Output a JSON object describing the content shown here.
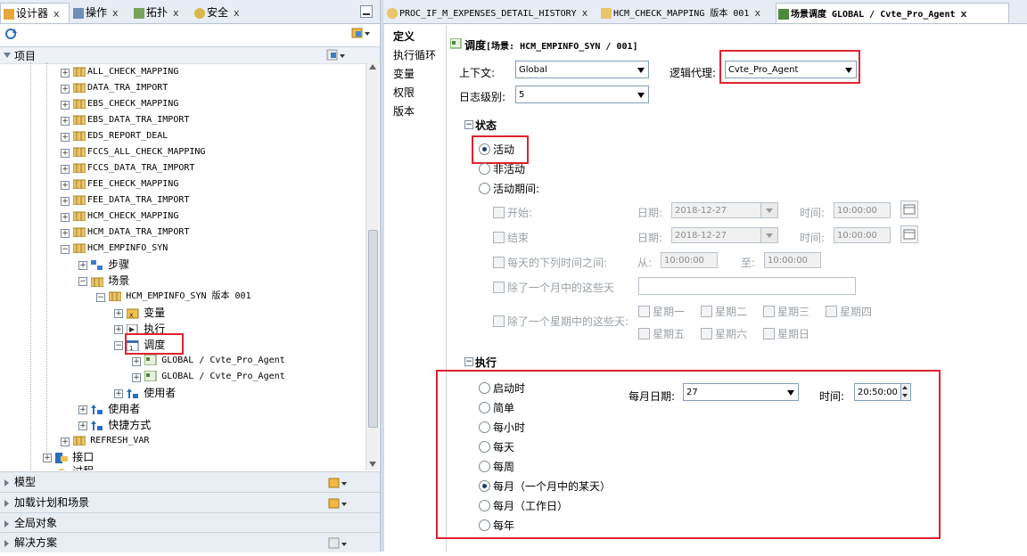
{
  "left_tabs": [
    {
      "label": "设计器",
      "close": "x"
    },
    {
      "label": "操作",
      "close": "x"
    },
    {
      "label": "拓扑",
      "close": "x"
    },
    {
      "label": "安全",
      "close": "x"
    }
  ],
  "project_header": "项目",
  "tree_items": [
    {
      "label": "ALL_CHECK_MAPPING"
    },
    {
      "label": "DATA_TRA_IMPORT"
    },
    {
      "label": "EBS_CHECK_MAPPING"
    },
    {
      "label": "EBS_DATA_TRA_IMPORT"
    },
    {
      "label": "EDS_REPORT_DEAL"
    },
    {
      "label": "FCCS_ALL_CHECK_MAPPING"
    },
    {
      "label": "FCCS_DATA_TRA_IMPORT"
    },
    {
      "label": "FEE_CHECK_MAPPING"
    },
    {
      "label": "FEE_DATA_TRA_IMPORT"
    },
    {
      "label": "HCM_CHECK_MAPPING"
    },
    {
      "label": "HCM_DATA_TRA_IMPORT"
    },
    {
      "label": "HCM_EMPINFO_SYN"
    }
  ],
  "tree_sub": {
    "steps": "步骤",
    "scenarios": "场景",
    "scenario_version": "HCM_EMPINFO_SYN 版本 001",
    "variables": "变量",
    "execution": "执行",
    "schedule": "调度",
    "sched1": "GLOBAL / Cvte_Pro_Agent",
    "sched2": "GLOBAL / Cvte_Pro_Agent",
    "users1": "使用者",
    "users2": "使用者",
    "shortcuts": "快捷方式",
    "refresh": "REFRESH_VAR",
    "interface": "接口",
    "process": "过程"
  },
  "bottom_sections": [
    "模型",
    "加载计划和场景",
    "全局对象",
    "解决方案"
  ],
  "right_tabs": [
    {
      "label": "PROC_IF_M_EXPENSES_DETAIL_HISTORY",
      "close": "x"
    },
    {
      "label": "HCM_CHECK_MAPPING 版本 001",
      "close": "x"
    },
    {
      "label": "场景调度 GLOBAL / Cvte_Pro_Agent",
      "close": "x"
    }
  ],
  "side_nav": [
    "定义",
    "执行循环",
    "变量",
    "权限",
    "版本"
  ],
  "form": {
    "title_cn": "调度",
    "title_detail": "[场景: HCM_EMPINFO_SYN / 001]",
    "context_label": "上下文:",
    "context_value": "Global",
    "agent_label": "逻辑代理:",
    "agent_value": "Cvte_Pro_Agent",
    "log_label": "日志级别:",
    "log_value": "5",
    "status_section": "状态",
    "status_active": "活动",
    "status_inactive": "非活动",
    "status_period": "活动期间:",
    "start": "开始:",
    "end": "结束",
    "date_label": "日期:",
    "date_start": "2018-12-27",
    "date_end": "2018-12-27",
    "time_label": "时间:",
    "time_start": "10:00:00",
    "time_end": "10:00:00",
    "daily_between": "每天的下列时间之间:",
    "from_label": "从:",
    "from_value": "10:00:00",
    "to_label": "至:",
    "to_value": "10:00:00",
    "except_month": "除了一个月中的这些天",
    "except_week": "除了一个星期中的这些天:",
    "weekdays": [
      "星期一",
      "星期二",
      "星期三",
      "星期四",
      "星期五",
      "星期六",
      "星期日"
    ],
    "exec_section": "执行",
    "exec_options": [
      "启动时",
      "简单",
      "每小时",
      "每天",
      "每周",
      "每月（一个月中的某天）",
      "每月（工作日）",
      "每年"
    ],
    "monthly_date_label": "每月日期:",
    "monthly_date_value": "27",
    "exec_time_label": "时间:",
    "exec_time_value": "20:50:00"
  }
}
